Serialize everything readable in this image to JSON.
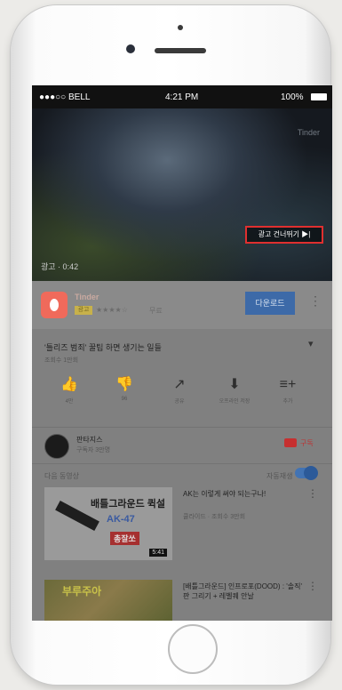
{
  "status_bar": {
    "carrier": "●●●○○ BELL",
    "time": "4:21 PM",
    "battery": "100%"
  },
  "video": {
    "skip_ad_label": "광고 건너뛰기 ▶|",
    "ad_time": "광고 · 0:42",
    "watermark": "Tinder"
  },
  "ad": {
    "app_name": "Tinder",
    "badge": "광고",
    "rating": "★★★★☆",
    "price": "무료",
    "install_label": "다운로드",
    "menu": "⋮"
  },
  "video_info": {
    "title": "'틀리즈 범죄' 꿀팁 하면 생기는 일들",
    "views": "조회수 1만회",
    "expand": "▾"
  },
  "actions": [
    {
      "icon": "👍",
      "label": "4만"
    },
    {
      "icon": "👎",
      "label": "96"
    },
    {
      "icon": "↗",
      "label": "공유"
    },
    {
      "icon": "⬇",
      "label": "오프라인 저장"
    },
    {
      "icon": "≡+",
      "label": "추가"
    }
  ],
  "channel": {
    "name": "판타지스",
    "subscribers": "구독자 3만명",
    "subscribe_label": "구독"
  },
  "up_next": {
    "heading": "다음 동영상",
    "autoplay_label": "자동재생"
  },
  "recommendations": [
    {
      "thumb_line1": "배틀그라운드 퀵설",
      "thumb_line2": "AK-47",
      "thumb_line3": "총잘쏘",
      "duration": "5:41",
      "title": "AK는 이렇게 써야 되는구나!",
      "subtitle": "쿨라이드 · 조회수 3만회",
      "menu": "⋮"
    },
    {
      "thumb_line1": "부루주아",
      "thumb_line2": "",
      "thumb_line3": "",
      "duration": "",
      "title": "[배틀그라운드] 인프로포(DOOD) : '솔직' 판 그리기 + 레벨퀘 안날",
      "subtitle": "",
      "menu": "⋮"
    }
  ]
}
